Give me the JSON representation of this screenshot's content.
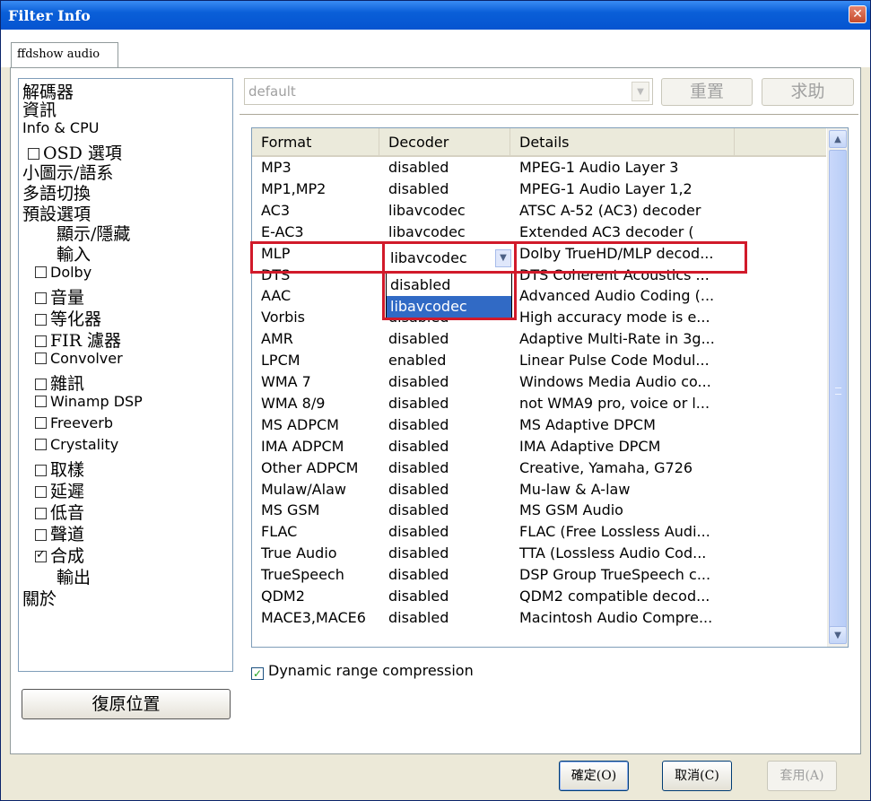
{
  "window": {
    "title": "Filter Info",
    "close_glyph": "✕"
  },
  "tabs": [
    {
      "label": "ffdshow audio"
    }
  ],
  "nav": {
    "items": [
      {
        "label": "解碼器"
      },
      {
        "label": "資訊"
      },
      {
        "label": "Info & CPU"
      },
      {
        "label": "OSD 選項",
        "checkbox": false
      },
      {
        "label": "小圖示/語系"
      },
      {
        "label": "多語切換"
      },
      {
        "label": "預設選項"
      },
      {
        "label": "顯示/隱藏"
      },
      {
        "label": "輸入"
      },
      {
        "label": "Dolby",
        "checkbox": false
      },
      {
        "label": "音量",
        "checkbox": false
      },
      {
        "label": "等化器",
        "checkbox": false
      },
      {
        "label": "FIR 濾器",
        "checkbox": false
      },
      {
        "label": "Convolver",
        "checkbox": false
      },
      {
        "label": "雜訊",
        "checkbox": false
      },
      {
        "label": "Winamp DSP",
        "checkbox": false
      },
      {
        "label": "Freeverb",
        "checkbox": false
      },
      {
        "label": "Crystality",
        "checkbox": false
      },
      {
        "label": "取樣",
        "checkbox": false
      },
      {
        "label": "延遲",
        "checkbox": false
      },
      {
        "label": "低音",
        "checkbox": false
      },
      {
        "label": "聲道",
        "checkbox": false
      },
      {
        "label": "合成",
        "checkbox": true
      },
      {
        "label": "輸出"
      },
      {
        "label": "關於"
      }
    ]
  },
  "restore_button": {
    "label": "復原位置"
  },
  "preset": {
    "value": "default"
  },
  "top_buttons": {
    "reset": "重置",
    "help": "求助"
  },
  "table": {
    "headers": [
      "Format",
      "Decoder",
      "Details"
    ],
    "rows": [
      [
        "MP3",
        "disabled",
        "MPEG-1 Audio Layer 3"
      ],
      [
        "MP1,MP2",
        "disabled",
        "MPEG-1 Audio Layer 1,2"
      ],
      [
        "AC3",
        "libavcodec",
        "ATSC A-52 (AC3) decoder"
      ],
      [
        "E-AC3",
        "libavcodec",
        "Extended AC3 decoder ("
      ],
      [
        "MLP",
        "libavcodec",
        "Dolby TrueHD/MLP decod..."
      ],
      [
        "DTS",
        "",
        "DTS Coherent Acoustics ..."
      ],
      [
        "AAC",
        "",
        "Advanced Audio Coding (..."
      ],
      [
        "Vorbis",
        "disabled",
        "High accuracy mode is e..."
      ],
      [
        "AMR",
        "disabled",
        "Adaptive Multi-Rate in 3g..."
      ],
      [
        "LPCM",
        "enabled",
        "Linear Pulse Code Modul..."
      ],
      [
        "WMA 7",
        "disabled",
        "Windows Media Audio co..."
      ],
      [
        "WMA 8/9",
        "disabled",
        "not WMA9 pro, voice or l..."
      ],
      [
        "MS ADPCM",
        "disabled",
        "MS Adaptive DPCM"
      ],
      [
        "IMA ADPCM",
        "disabled",
        "IMA Adaptive DPCM"
      ],
      [
        "Other ADPCM",
        "disabled",
        "Creative, Yamaha, G726"
      ],
      [
        "Mulaw/Alaw",
        "disabled",
        "Mu-law & A-law"
      ],
      [
        "MS GSM",
        "disabled",
        "MS GSM Audio"
      ],
      [
        "FLAC",
        "disabled",
        "FLAC (Free Lossless Audi..."
      ],
      [
        "True Audio",
        "disabled",
        "TTA (Lossless Audio Cod..."
      ],
      [
        "TrueSpeech",
        "disabled",
        "DSP Group TrueSpeech c..."
      ],
      [
        "QDM2",
        "disabled",
        "QDM2 compatible decod..."
      ],
      [
        "MACE3,MACE6",
        "disabled",
        "Macintosh Audio Compre..."
      ]
    ],
    "editing_row": 4,
    "combo_value": "libavcodec",
    "dropdown_options": [
      "disabled",
      "libavcodec"
    ],
    "dropdown_selected": 1
  },
  "drc": {
    "label": "Dynamic range compression",
    "checked": true
  },
  "footer": {
    "ok": "確定(O)",
    "cancel": "取消(C)",
    "apply": "套用(A)"
  }
}
